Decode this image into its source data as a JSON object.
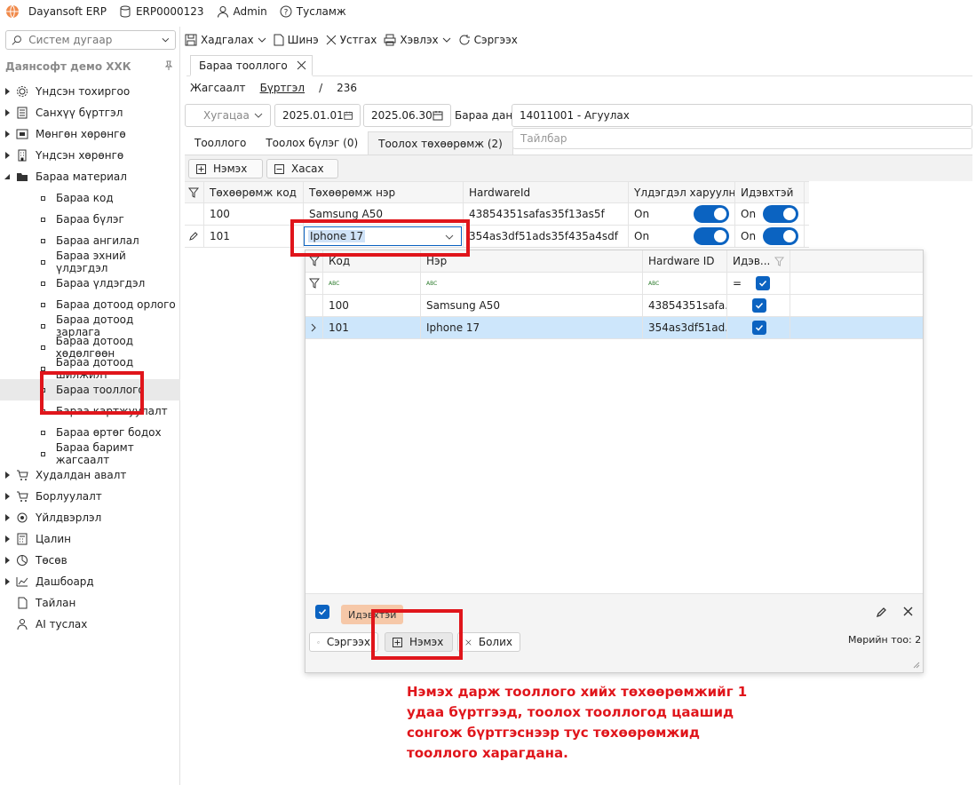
{
  "titlebar": {
    "app_name": "Dayansoft ERP",
    "db_code": "ERP0000123",
    "user": "Admin",
    "help": "Тусламж"
  },
  "sidebar": {
    "search_placeholder": "Систем дугаар",
    "company": "Даянсофт демо ХХК",
    "items_before": [
      {
        "label": "Үндсэн тохиргоо",
        "icon": "gear-icon"
      },
      {
        "label": "Санхүү бүртгэл",
        "icon": "ledger-icon"
      },
      {
        "label": "Мөнгөн хөрөнгө",
        "icon": "money-icon"
      },
      {
        "label": "Үндсэн хөрөнгө",
        "icon": "building-icon"
      }
    ],
    "inventory": {
      "label": "Бараа материал",
      "icon": "folder-icon"
    },
    "inventory_children": [
      "Бараа код",
      "Бараа бүлэг",
      "Бараа ангилал",
      "Бараа эхний үлдэгдэл",
      "Бараа үлдэгдэл",
      "Бараа дотоод орлого",
      "Бараа дотоод зарлага",
      "Бараа дотоод хөдөлгөөн",
      "Бараа дотоод шилжилт",
      "Бараа тооллого",
      "Бараа картжуулалт",
      "Бараа өртөг бодох",
      "Бараа баримт жагсаалт"
    ],
    "selected_child": "Бараа тооллого",
    "items_after": [
      {
        "label": "Худалдан авалт",
        "icon": "cart-icon"
      },
      {
        "label": "Борлуулалт",
        "icon": "cart-icon"
      },
      {
        "label": "Үйлдвэрлэл",
        "icon": "factory-icon"
      },
      {
        "label": "Цалин",
        "icon": "calculator-icon"
      },
      {
        "label": "Төсөв",
        "icon": "pie-icon"
      },
      {
        "label": "Дашбоард",
        "icon": "dashboard-icon"
      },
      {
        "label": "Тайлан",
        "icon": "report-icon"
      },
      {
        "label": "AI туслах",
        "icon": "ai-icon"
      }
    ]
  },
  "toolbar": {
    "save": "Хадгалах",
    "new": "Шинэ",
    "delete": "Устгах",
    "print": "Хэвлэх",
    "refresh": "Сэргээх"
  },
  "document_tab": "Бараа тооллого",
  "subnav": {
    "list": "Жагсаалт",
    "register": "Бүртгэл",
    "separator": "/",
    "number": "236"
  },
  "filters": {
    "period_placeholder": "Хугацаа",
    "date_from": "2025.01.01",
    "date_to": "2025.06.30",
    "account_label": "Бараа данс",
    "account_value": "14011001 - Агуулах",
    "description_placeholder": "Тайлбар"
  },
  "inner_tabs": [
    "Тооллого",
    "Тоолох бүлэг (0)",
    "Тоолох төхөөрөмж (2)"
  ],
  "grid_buttons": {
    "add": "Нэмэх",
    "remove": "Хасах"
  },
  "grid": {
    "columns": [
      "Төхөөрөмж код",
      "Төхөөрөмж нэр",
      "HardwareId",
      "Үлдэгдэл харуулна",
      "Идэвхтэй"
    ],
    "rows": [
      {
        "code": "100",
        "name": "Samsung A50",
        "hardware": "43854351safas35f13as5f",
        "show_balance": "On",
        "active": "On"
      },
      {
        "code": "101",
        "name": "Iphone 17",
        "hardware": "354as3df51ads35f435a4sdf",
        "show_balance": "On",
        "active": "On"
      }
    ]
  },
  "popup": {
    "columns": [
      "Код",
      "Нэр",
      "Hardware ID",
      "Идэв..."
    ],
    "filter_type_label": "ABC",
    "filter_equals": "=",
    "rows": [
      {
        "code": "100",
        "name": "Samsung A50",
        "hardware": "43854351safa..."
      },
      {
        "code": "101",
        "name": "Iphone 17",
        "hardware": "354as3df51ad..."
      }
    ],
    "filter_chip": "Идэвхтэй",
    "refresh": "Сэргээх",
    "add": "Нэмэх",
    "cancel": "Болих",
    "row_count": "Мөрийн тоо: 2"
  },
  "annotation": "Нэмэх дарж тооллого хийх төхөөрөмжийг 1 удаа бүртгээд, тоолох тооллогод цаашид сонгож бүртгэснээр тус төхөөрөмжид тооллого харагдана.",
  "colors": {
    "accent": "#0b63c1",
    "annotation": "#e0151b",
    "logo": "#f08a4b"
  }
}
